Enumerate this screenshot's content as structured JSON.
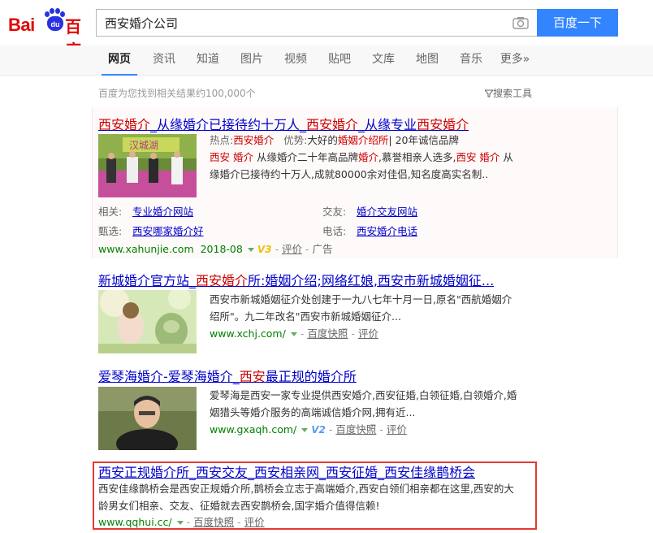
{
  "search": {
    "query": "西安婚介公司",
    "button_label": "百度一下"
  },
  "logo": {
    "bai": "Bai",
    "du": "du",
    "cn": "百度"
  },
  "nav": {
    "tabs": [
      {
        "label": "网页",
        "active": true
      },
      {
        "label": "资讯"
      },
      {
        "label": "知道"
      },
      {
        "label": "图片"
      },
      {
        "label": "视频"
      },
      {
        "label": "贴吧"
      },
      {
        "label": "文库"
      },
      {
        "label": "地图"
      },
      {
        "label": "音乐"
      },
      {
        "label": "更多»"
      }
    ]
  },
  "stats": "百度为您找到相关结果约100,000个",
  "search_tools": "搜索工具",
  "results": [
    {
      "type": "ad",
      "title_parts": [
        "西安婚介",
        "_从缘婚介已接待约十万人_",
        "西安婚介",
        "_从缘专业",
        "西安婚介"
      ],
      "hot_label": "热点:",
      "hot_value": "西安婚介",
      "adv_label": "优势:",
      "adv_value_pre": "大好的",
      "adv_value_em": "婚姻介绍所",
      "adv_value_post": "| 20年诚信品牌",
      "desc_line1_parts": [
        "西安 婚介",
        " 从缘婚介二十年高品牌",
        "婚介",
        ",慕誉相亲人选多,",
        "西安 婚介",
        " 从"
      ],
      "desc_line2": "缘婚介已接待约十万人,成就80000余对佳侣,知名度高实名制..",
      "related_label": "相关:",
      "related_link": "专业婚介网站",
      "friend_label": "交友:",
      "friend_link": "婚介交友网站",
      "select_label": "甄选:",
      "select_link": "西安哪家婚介好",
      "phone_label": "电话:",
      "phone_link": "西安婚介电话",
      "url": "www.xahunjie.com",
      "date": "2018-08",
      "badge": "V3",
      "review": "评价",
      "ad_label": "广告"
    },
    {
      "title_parts": [
        "新城婚介官方站_",
        "西安婚介",
        "所:婚姻介绍;网络红娘,西安市新城婚姻征..."
      ],
      "desc_line1": "西安市新城婚姻征介处创建于一九八七年十月一日,原名\"西航婚姻介",
      "desc_line2": "绍所\"。九二年改名\"西安市新城婚姻征介...",
      "url": "www.xchj.com/",
      "snapshot": "百度快照",
      "review": "评价"
    },
    {
      "title_parts": [
        "爱琴海婚介-爱琴海婚介_",
        "西安",
        "最正规的婚介所"
      ],
      "desc_line1": "爱琴海是西安一家专业提供西安婚介,西安征婚,白领征婚,白领婚介,婚",
      "desc_line2": "姻猎头等婚介服务的高端诚信婚介网,拥有近...",
      "url": "www.gxaqh.com/",
      "badge": "V2",
      "snapshot": "百度快照",
      "review": "评价"
    },
    {
      "title_parts": [
        "西安正规婚介所",
        "_",
        "西安交友",
        "_",
        "西安相亲网",
        "_",
        "西安征婚",
        "_",
        "西安佳缘鹊桥会"
      ],
      "desc_line1": "西安佳缘鹊桥会是西安正规婚介所,鹊桥会立志于高端婚介,西安白领们相亲都在这里,西安的大",
      "desc_line2": "龄男女们相亲、交友、征婚就去西安鹊桥会,国字婚介值得信赖!",
      "url": "www.qqhui.cc/",
      "snapshot": "百度快照",
      "review": "评价"
    }
  ]
}
